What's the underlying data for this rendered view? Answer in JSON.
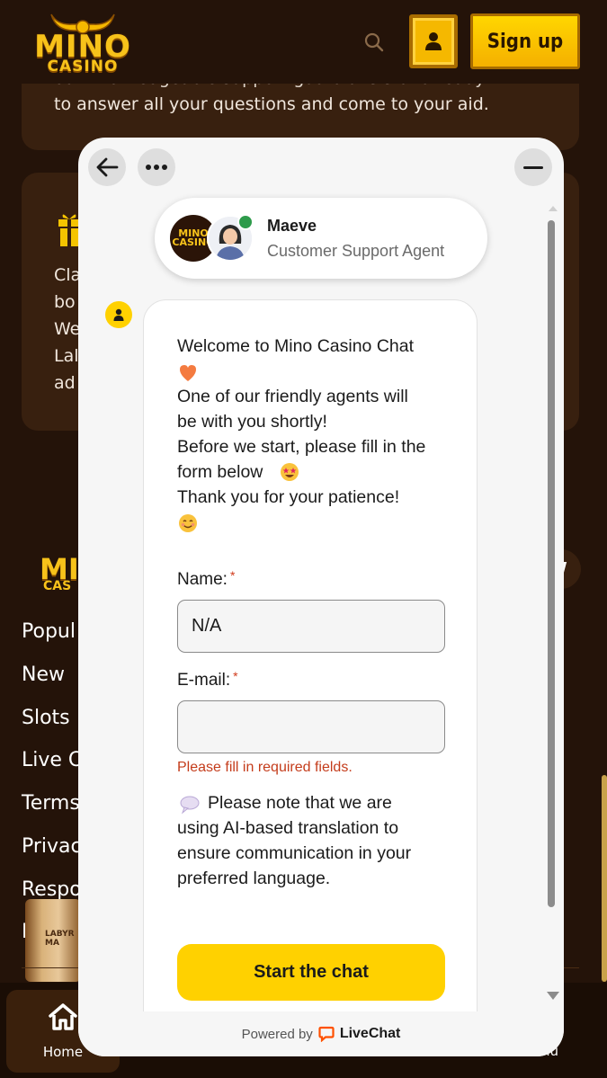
{
  "header": {
    "logo_line1": "MINO",
    "logo_line2": "CASINO",
    "signup_label": "Sign up"
  },
  "background": {
    "card1_line1": "our knowledgeable support guardians stand ready",
    "card1_line2": "to answer all your questions and come to your aid.",
    "card2_lines": [
      "Cla",
      "bo",
      "We",
      "Lal",
      "ad"
    ],
    "footer_logo_line1": "MIN",
    "footer_logo_line2": "CAS",
    "nav_links": [
      "Popul",
      "New",
      "Slots",
      "Live C",
      "Terms",
      "Privac",
      "Respo",
      "E"
    ],
    "promo_image_text": "LABYR MA",
    "bottom_nav": {
      "home_label": "Home",
      "menu_fragment": "nu"
    }
  },
  "chat": {
    "agent_name": "Maeve",
    "agent_role": "Customer Support Agent",
    "agent_avatar_text": "MINO CASINO",
    "welcome_lines": [
      "Welcome to Mino Casino Chat",
      "One of our friendly agents will",
      "be with you shortly!",
      "Before we start, please fill in the",
      "form below",
      "Thank you for your patience!"
    ],
    "form": {
      "name_label": "Name:",
      "name_value": "N/A",
      "email_label": "E-mail:",
      "email_value": "",
      "required_mark": "*",
      "error_text": "Please fill in required fields."
    },
    "note_lines": [
      "Please note that we are",
      "using AI-based translation to",
      "ensure communication in your",
      "preferred language."
    ],
    "start_button": "Start the chat",
    "powered_by": "Powered by",
    "powered_brand": "LiveChat"
  },
  "colors": {
    "page_bg": "#241309",
    "card_bg": "#38200f",
    "accent_yellow": "#ffd100",
    "gold": "#f7c21a",
    "error_red": "#c43c1b",
    "online_green": "#2e9b4b"
  }
}
